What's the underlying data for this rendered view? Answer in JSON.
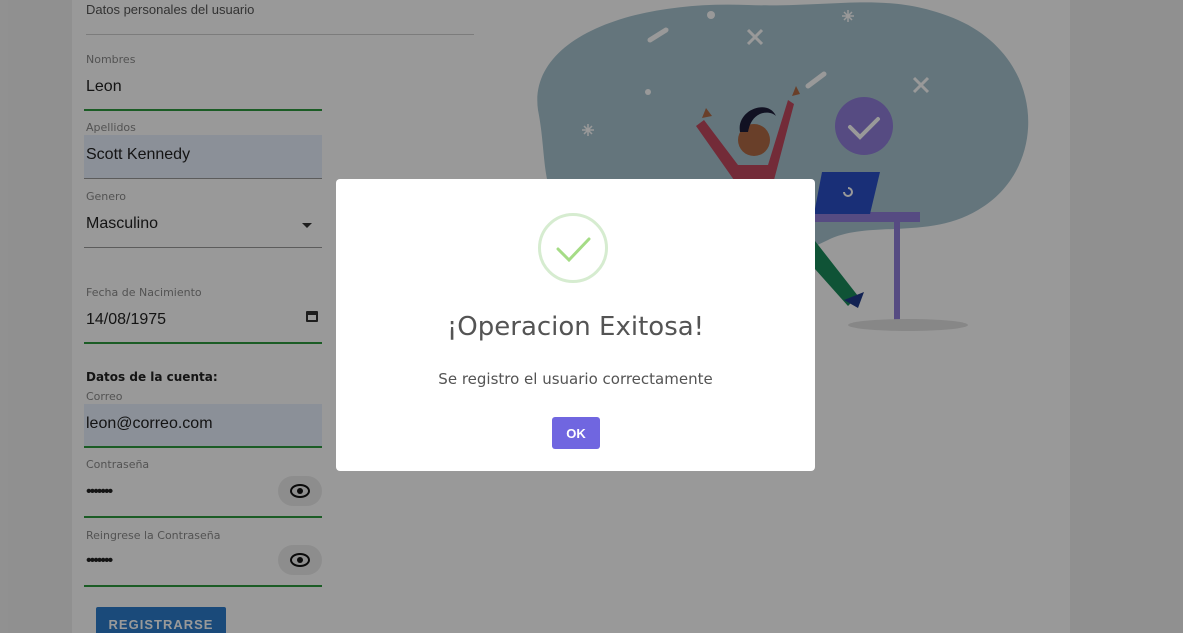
{
  "form": {
    "section_title": "Datos personales del usuario",
    "nombres": {
      "label": "Nombres",
      "value": "Leon"
    },
    "apellidos": {
      "label": "Apellidos",
      "value": "Scott Kennedy"
    },
    "genero": {
      "label": "Genero",
      "value": "Masculino"
    },
    "fecha": {
      "label": "Fecha de Nacimiento",
      "value": "14/08/1975"
    },
    "cuenta_title": "Datos de la cuenta:",
    "correo": {
      "label": "Correo",
      "value": "leon@correo.com"
    },
    "password": {
      "label": "Contraseña",
      "value": "•••••••"
    },
    "password2": {
      "label": "Reingrese la Contraseña",
      "value": "•••••••"
    },
    "register_label": "REGISTRARSE"
  },
  "illustration": {
    "icons": [
      "person-celebrating-illustration",
      "laptop-icon",
      "check-badge-icon",
      "sparkle-icon"
    ]
  },
  "modal": {
    "icon": "success-check-icon",
    "title": "¡Operacion Exitosa!",
    "text": "Se registro el usuario correctamente",
    "ok_label": "OK"
  },
  "colors": {
    "underline_valid": "#2e9a3e",
    "primary_button": "#2c7ccc",
    "ok_button": "#7066e0",
    "blob": "#a7c4cf",
    "accent_purple": "#8f7dd9"
  }
}
